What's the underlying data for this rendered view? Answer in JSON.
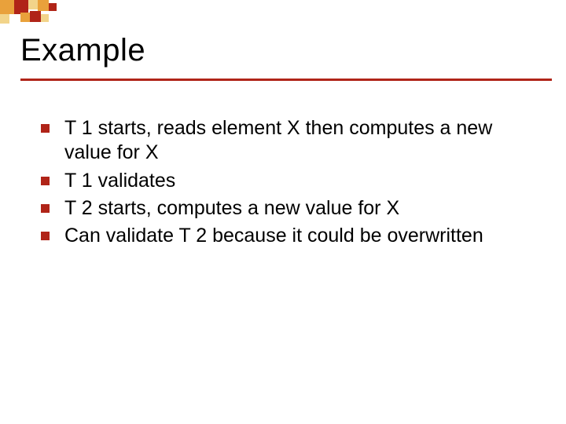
{
  "title": "Example",
  "bullets": [
    "T 1 starts, reads element X then  computes a new value for X",
    "T 1 validates",
    "T 2 starts, computes a new value for X",
    "Can validate T 2 because it could be overwritten"
  ],
  "colors": {
    "accent": "#b02418",
    "deco1": "#e9a13b",
    "deco2": "#f2d48a",
    "deco3": "#b02418"
  }
}
